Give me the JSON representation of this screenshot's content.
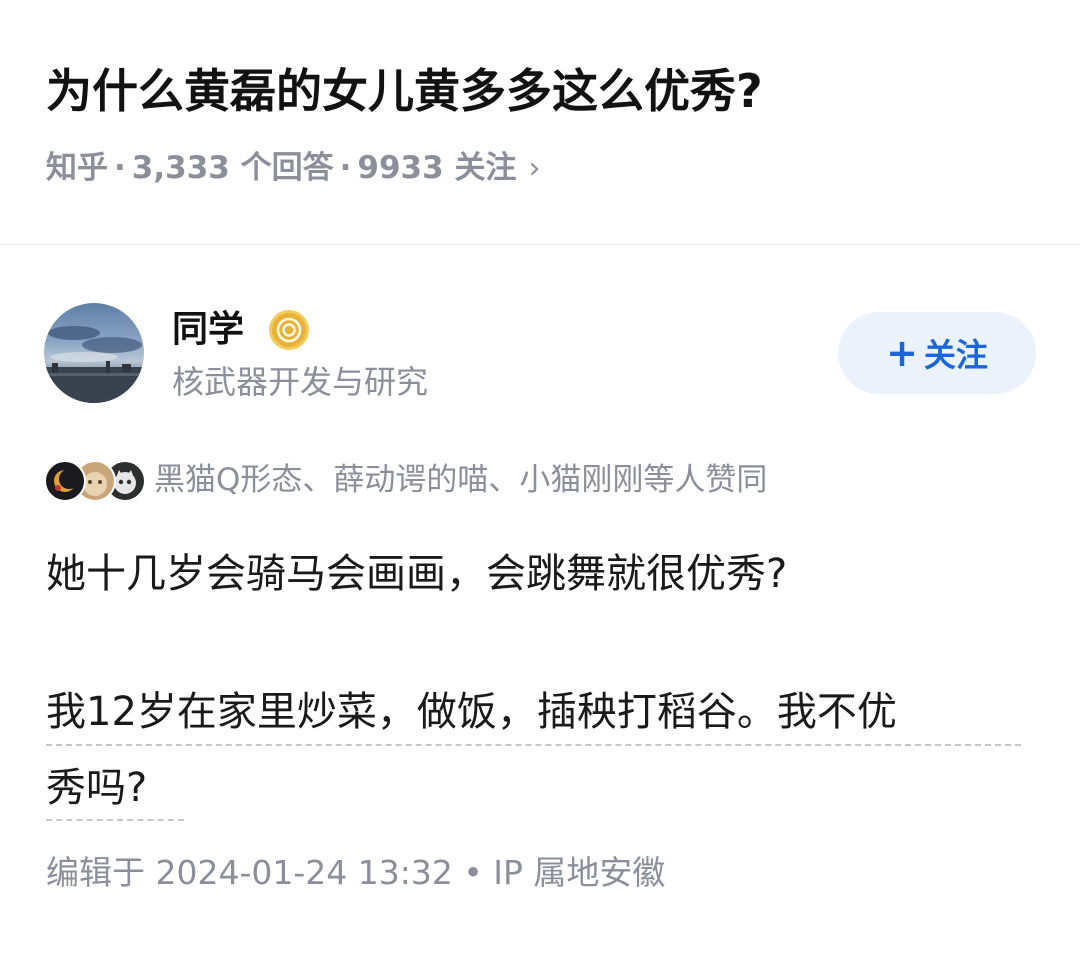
{
  "question": {
    "title": "为什么黄磊的女儿黄多多这么优秀?",
    "source": "知乎",
    "separator": "·",
    "answers": "3,333 个回答",
    "followers": "9933 关注",
    "chevron": "›"
  },
  "author": {
    "name": "同学",
    "bio": "核武器开发与研究",
    "avatar_icon": "avatar-sky-photo",
    "badge_icon": "certified-badge-icon",
    "badge_color": "#e8b23a"
  },
  "follow_button": {
    "plus": "+",
    "label": "关注",
    "color": "#1a66d8",
    "background": "#ebf2fc"
  },
  "endorsement": {
    "text": "黑猫Q形态、薛动谔的喵、小猫刚刚等人赞同"
  },
  "answer": {
    "paragraph_1": "她十几岁会骑马会画画，会跳舞就很优秀?",
    "paragraph_2_line_1": "我12岁在家里炒菜，做饭，插秧打稻谷。我不优",
    "paragraph_2_line_2": "秀吗?"
  },
  "footer": {
    "edit_info": "编辑于 2024-01-24 13:32 • IP 属地安徽"
  }
}
